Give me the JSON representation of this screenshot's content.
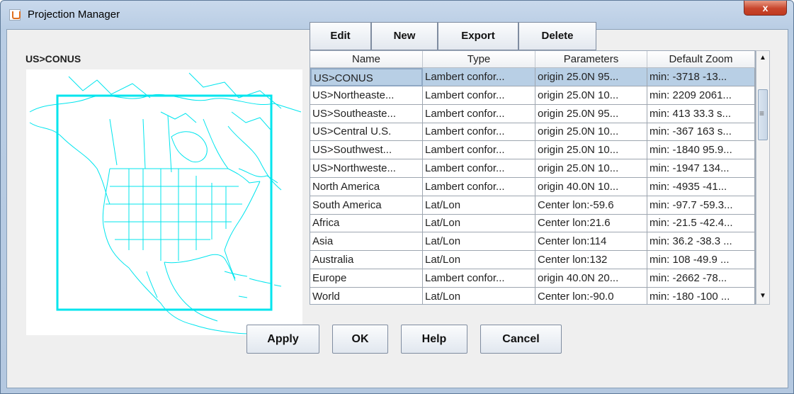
{
  "window": {
    "title": "Projection Manager",
    "close_label": "x"
  },
  "map": {
    "label": "US>CONUS"
  },
  "toolbar": {
    "edit": "Edit",
    "new": "New",
    "export": "Export",
    "delete": "Delete"
  },
  "table": {
    "columns": [
      "Name",
      "Type",
      "Parameters",
      "Default Zoom"
    ],
    "rows": [
      [
        "US>CONUS",
        "Lambert confor...",
        " origin 25.0N 95...",
        "min: -3718 -13..."
      ],
      [
        "US>Northeaste...",
        "Lambert confor...",
        " origin 25.0N 10...",
        "min: 2209 2061..."
      ],
      [
        "US>Southeaste...",
        "Lambert confor...",
        " origin 25.0N 95...",
        "min: 413 33.3 s..."
      ],
      [
        "US>Central U.S.",
        "Lambert confor...",
        " origin 25.0N 10...",
        "min: -367 163 s..."
      ],
      [
        "US>Southwest...",
        "Lambert confor...",
        " origin 25.0N 10...",
        "min: -1840 95.9..."
      ],
      [
        "US>Northweste...",
        "Lambert confor...",
        " origin 25.0N 10...",
        "min: -1947 134..."
      ],
      [
        "North America",
        "Lambert confor...",
        " origin 40.0N 10...",
        "min: -4935 -41..."
      ],
      [
        "South America",
        "Lat/Lon",
        "Center lon:-59.6",
        "min: -97.7 -59.3..."
      ],
      [
        "Africa",
        "Lat/Lon",
        "Center lon:21.6",
        "min: -21.5 -42.4..."
      ],
      [
        "Asia",
        "Lat/Lon",
        "Center lon:114",
        "min: 36.2 -38.3 ..."
      ],
      [
        "Australia",
        "Lat/Lon",
        "Center lon:132",
        "min: 108 -49.9 ..."
      ],
      [
        "Europe",
        "Lambert confor...",
        " origin 40.0N 20...",
        "min: -2662 -78..."
      ],
      [
        "World",
        "Lat/Lon",
        "Center lon:-90.0",
        "min: -180 -100 ..."
      ]
    ],
    "selected_index": 0
  },
  "buttons": {
    "apply": "Apply",
    "ok": "OK",
    "help": "Help",
    "cancel": "Cancel"
  },
  "colors": {
    "map_lines": "#00e5ee",
    "selection": "#b8cfe5"
  }
}
